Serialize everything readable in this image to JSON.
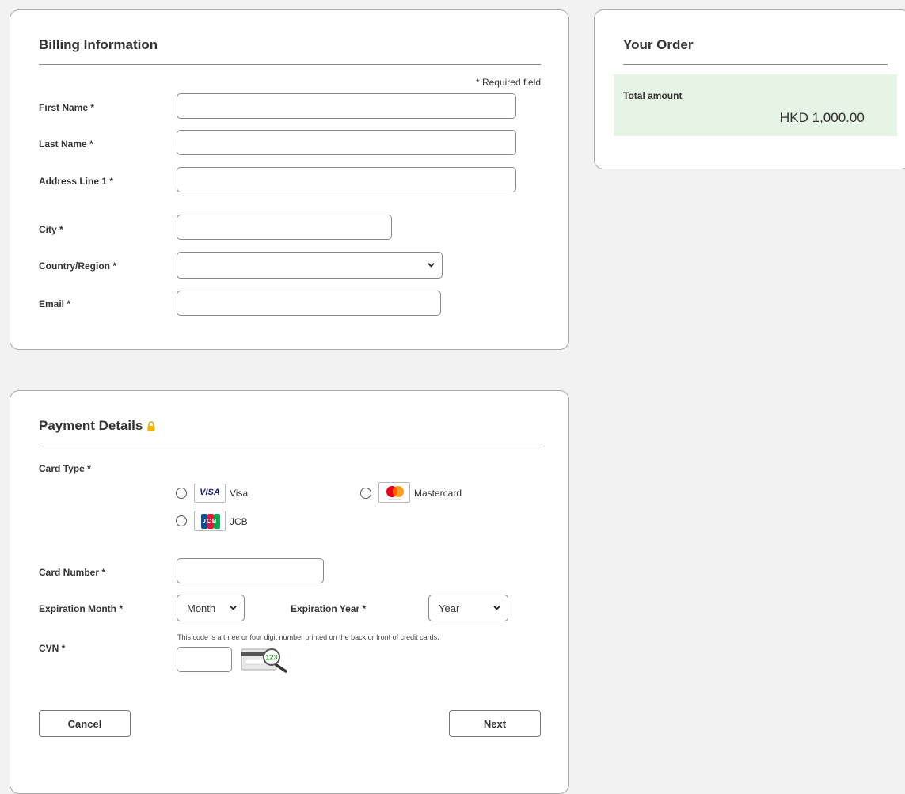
{
  "billing": {
    "title": "Billing Information",
    "required_note": "* Required field",
    "fields": {
      "first_name": {
        "label": "First Name *",
        "value": ""
      },
      "last_name": {
        "label": "Last Name *",
        "value": ""
      },
      "address1": {
        "label": "Address Line 1 *",
        "value": ""
      },
      "city": {
        "label": "City *",
        "value": ""
      },
      "country": {
        "label": "Country/Region *",
        "selected": ""
      },
      "email": {
        "label": "Email *",
        "value": ""
      }
    }
  },
  "order": {
    "title": "Your Order",
    "total_label": "Total amount",
    "total_value": "HKD 1,000.00",
    "accent_color": "#e6f4e6"
  },
  "payment": {
    "title": "Payment Details",
    "lock_icon": "lock-icon",
    "card_type_label": "Card Type *",
    "card_types": [
      {
        "name": "Visa",
        "logo_text": "VISA",
        "icon": "visa-logo"
      },
      {
        "name": "Mastercard",
        "logo_text": "mastercard",
        "icon": "mastercard-logo"
      },
      {
        "name": "JCB",
        "logo_text": "JCB",
        "icon": "jcb-logo"
      }
    ],
    "card_number_label": "Card Number *",
    "exp_month_label": "Expiration Month *",
    "exp_month_selected": "Month",
    "exp_year_label": "Expiration Year *",
    "exp_year_selected": "Year",
    "cvn_label": "CVN *",
    "cvn_hint": "This code is a three or four digit number printed on the back or front of credit cards.",
    "cvn_icon_text": "123",
    "cancel_label": "Cancel",
    "next_label": "Next"
  }
}
